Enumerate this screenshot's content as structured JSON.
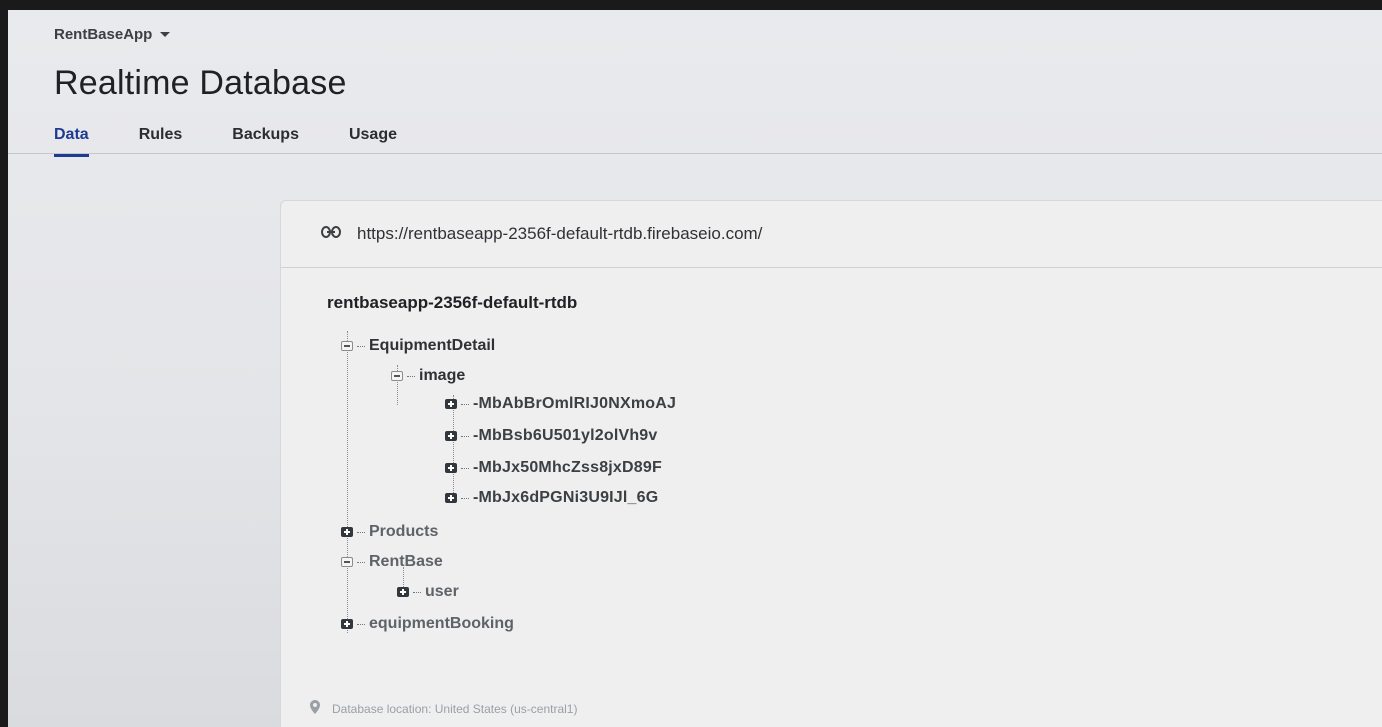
{
  "header": {
    "project_name": "RentBaseApp",
    "page_title": "Realtime Database"
  },
  "tabs": [
    {
      "label": "Data",
      "active": true
    },
    {
      "label": "Rules",
      "active": false
    },
    {
      "label": "Backups",
      "active": false
    },
    {
      "label": "Usage",
      "active": false
    }
  ],
  "database": {
    "url": "https://rentbaseapp-2356f-default-rtdb.firebaseio.com/",
    "root": "rentbaseapp-2356f-default-rtdb",
    "tree": {
      "equipment_detail": "EquipmentDetail",
      "image": "image",
      "image_keys": [
        "-MbAbBrOmlRIJ0NXmoAJ",
        "-MbBsb6U501yl2olVh9v",
        "-MbJx50MhcZss8jxD89F",
        "-MbJx6dPGNi3U9IJl_6G"
      ],
      "products": "Products",
      "rent_base": "RentBase",
      "user": "user",
      "equipment_booking": "equipmentBooking"
    },
    "location": "Database location: United States (us-central1)"
  },
  "icons": {
    "project_dropdown": "chevron-down-icon",
    "url": "link-icon",
    "location": "location-pin-icon"
  }
}
